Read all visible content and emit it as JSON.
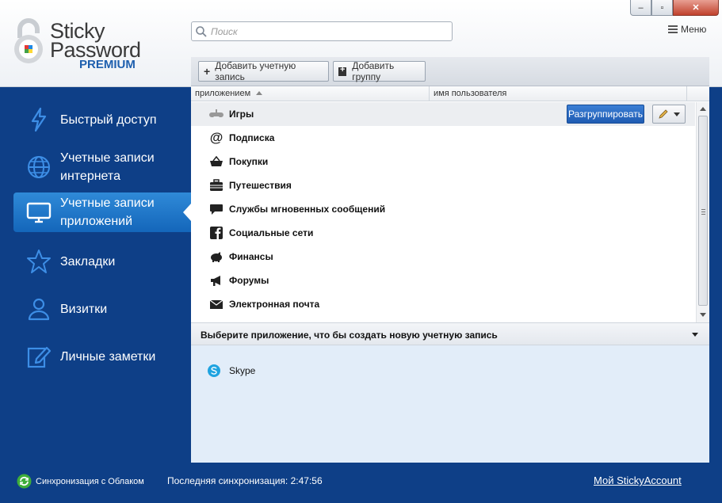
{
  "app": {
    "logo_line1": "Sticky",
    "logo_line2": "Password",
    "logo_line3": "PREMIUM"
  },
  "search": {
    "placeholder": "Поиск"
  },
  "window_controls": {
    "minimize": "–",
    "maximize": "▫",
    "close": "✕"
  },
  "menu": {
    "label": "Меню"
  },
  "sidebar": {
    "items": [
      {
        "label": "Быстрый доступ",
        "icon": "lightning-icon",
        "active": false
      },
      {
        "label": "Учетные записи интернета",
        "icon": "globe-icon",
        "active": false
      },
      {
        "label": "Учетные записи приложений",
        "icon": "monitor-icon",
        "active": true
      },
      {
        "label": "Закладки",
        "icon": "star-icon",
        "active": false
      },
      {
        "label": "Визитки",
        "icon": "person-icon",
        "active": false
      },
      {
        "label": "Личные заметки",
        "icon": "note-edit-icon",
        "active": false
      }
    ]
  },
  "toolbar": {
    "add_account": "Добавить учетную запись",
    "add_group": "Добавить группу"
  },
  "columns": {
    "col1": "приложением",
    "col2": "имя пользователя"
  },
  "groups": [
    {
      "label": "Игры",
      "icon": "gamepad-icon",
      "selected": true
    },
    {
      "label": "Подписка",
      "icon": "at-icon",
      "selected": false
    },
    {
      "label": "Покупки",
      "icon": "basket-icon",
      "selected": false
    },
    {
      "label": "Путешествия",
      "icon": "luggage-icon",
      "selected": false
    },
    {
      "label": "Службы мгновенных сообщений",
      "icon": "chat-bubble-icon",
      "selected": false
    },
    {
      "label": "Социальные сети",
      "icon": "facebook-icon",
      "selected": false
    },
    {
      "label": "Финансы",
      "icon": "piggy-bank-icon",
      "selected": false
    },
    {
      "label": "Форумы",
      "icon": "megaphone-icon",
      "selected": false
    },
    {
      "label": "Электронная почта",
      "icon": "envelope-icon",
      "selected": false
    }
  ],
  "row_actions": {
    "ungroup": "Разгруппировать"
  },
  "app_picker": {
    "label": "Выберите приложение, что бы создать новую учетную запись",
    "apps": [
      {
        "label": "Skype",
        "icon": "skype-icon"
      }
    ]
  },
  "footer": {
    "sync_label": "Синхронизация с Облаком",
    "last_sync": "Последняя синхронизация: 2:47:56",
    "account_link": "Мой StickyAccount"
  },
  "colors": {
    "sidebar_bg": "#0e3f87",
    "active_item": "#1e73c8",
    "ungroup_button": "#2a6cc4",
    "app_area": "#e2edf9"
  }
}
